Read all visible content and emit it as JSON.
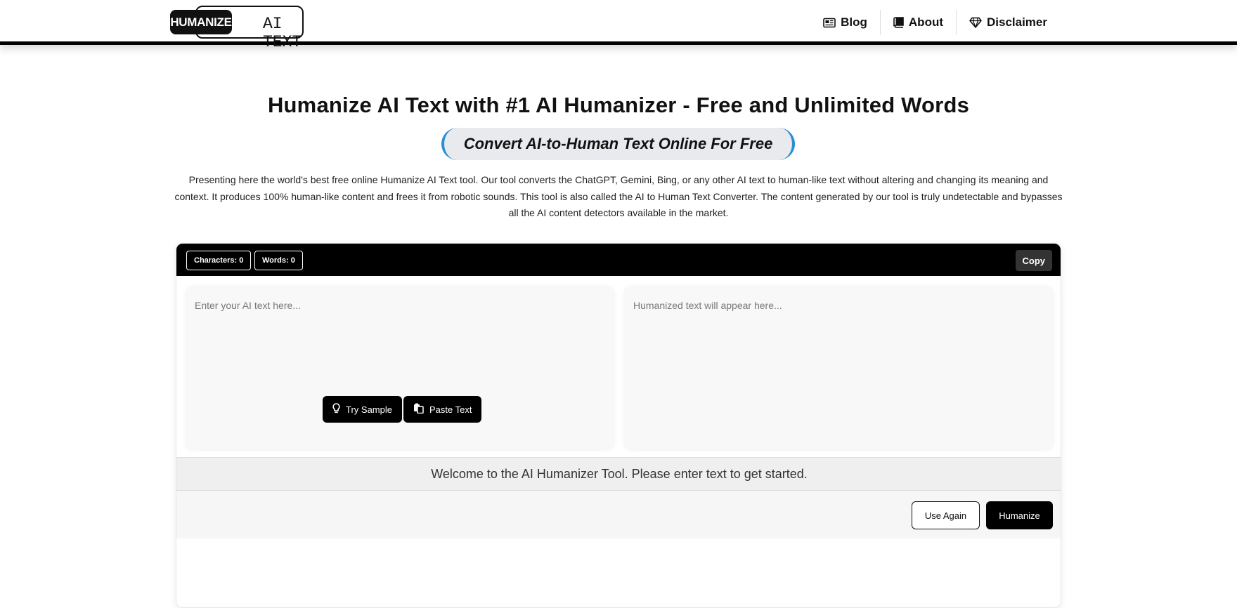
{
  "header": {
    "logo_dark_text": "HUMANIZE",
    "logo_light_text": "AI TEXT",
    "nav": [
      {
        "label": "Blog",
        "icon": "newspaper-icon"
      },
      {
        "label": "About",
        "icon": "book-icon"
      },
      {
        "label": "Disclaimer",
        "icon": "diamond-icon"
      }
    ]
  },
  "hero": {
    "title": "Humanize AI Text with #1 AI Humanizer - Free and Unlimited Words",
    "subtitle": "Convert AI-to-Human Text Online For Free",
    "description": "Presenting here the world's best free online Humanize AI Text tool. Our tool converts the ChatGPT, Gemini, Bing, or any other AI text to human-like text without altering and changing its meaning and context. It produces 100% human-like content and frees it from robotic sounds. This tool is also called the AI to Human Text Converter. The content generated by our tool is truly undetectable and bypasses all the AI content detectors available in the market."
  },
  "tool": {
    "characters_label": "Characters: 0",
    "words_label": "Words: 0",
    "copy_label": "Copy",
    "input_placeholder": "Enter your AI text here...",
    "output_placeholder": "Humanized text will appear here...",
    "try_sample_label": "Try Sample",
    "paste_text_label": "Paste Text",
    "status_message": "Welcome to the AI Humanizer Tool. Please enter text to get started.",
    "use_again_label": "Use Again",
    "humanize_label": "Humanize"
  },
  "colors": {
    "accent_blue": "#2a8fd6",
    "toolbar_bg": "#000000",
    "panel_bg": "#f8f8f8"
  }
}
